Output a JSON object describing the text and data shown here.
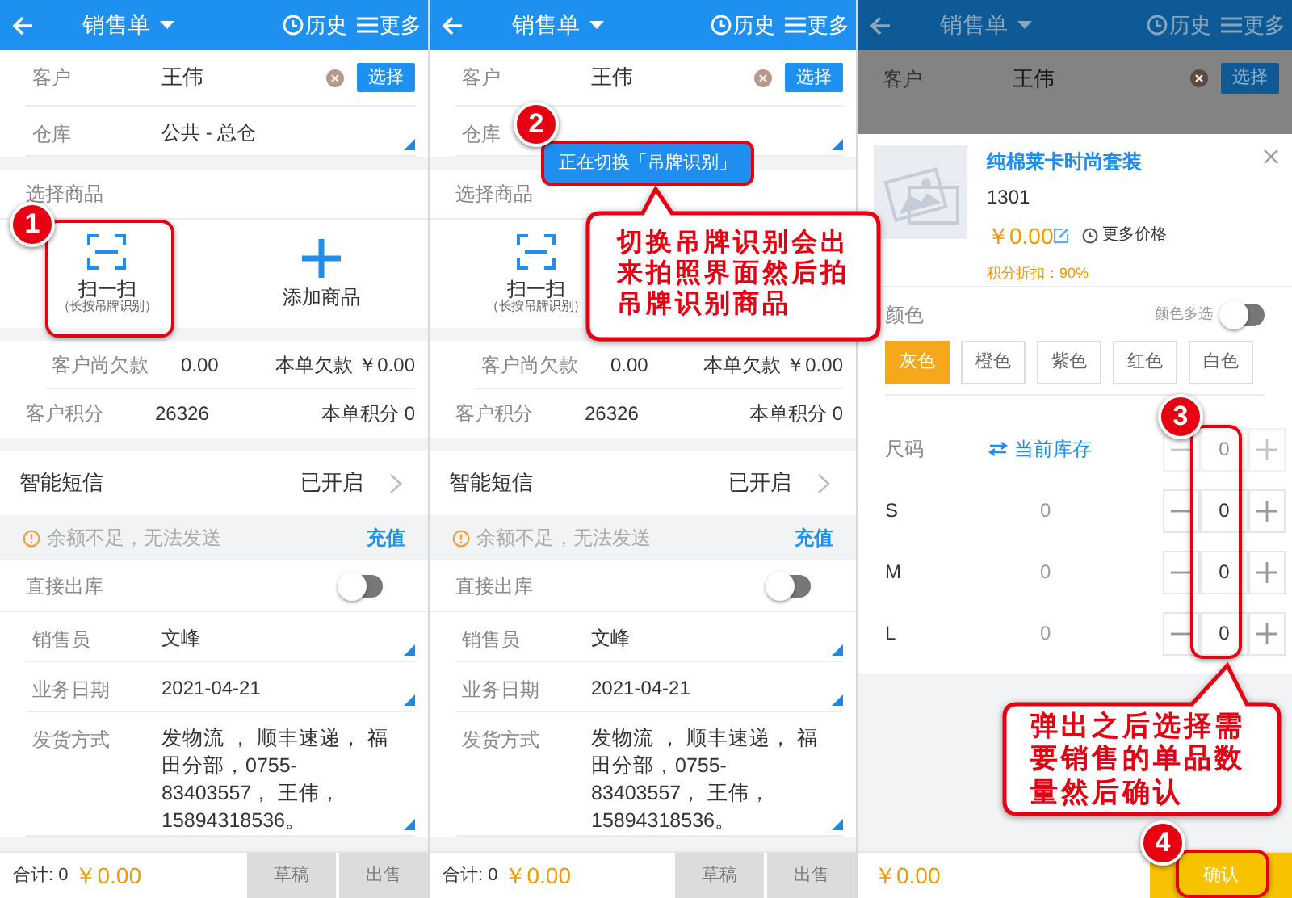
{
  "screens": [
    {
      "kind": "form",
      "header": {
        "title": "销售单",
        "history": "历史",
        "more": "更多"
      },
      "customer": {
        "label": "客户",
        "value": "王伟",
        "button": "选择"
      },
      "warehouse": {
        "label": "仓库",
        "value": "公共 - 总仓"
      },
      "goods_title": "选择商品",
      "tiles": [
        {
          "kind": "scan",
          "label": "扫一扫",
          "hint": "（长按吊牌识别）"
        },
        {
          "kind": "add",
          "label": "添加商品"
        }
      ],
      "stats": [
        {
          "label": "客户尚欠款",
          "value": "0.00",
          "extra": "本单欠款 ￥0.00"
        },
        {
          "label": "客户积分",
          "value": "26326",
          "extra": "本单积分 0"
        }
      ],
      "sms": {
        "label": "智能短信",
        "value": "已开启"
      },
      "notice": {
        "text": "余额不足，无法发送",
        "link": "充值"
      },
      "direct_out": {
        "label": "直接出库",
        "on": false
      },
      "fields": [
        {
          "label": "销售员",
          "value": "文峰"
        },
        {
          "label": "业务日期",
          "value": "2021-04-21"
        },
        {
          "label": "发货方式",
          "value": "发物流 ， 顺丰速递， 福田分部，0755-83403557， 王伟， 15894318536。"
        }
      ],
      "footer": {
        "total": "合计: 0",
        "amount": "￥0.00",
        "buttons": [
          {
            "label": "草稿",
            "disabled": true
          },
          {
            "label": "出售",
            "disabled": true
          }
        ]
      }
    },
    {
      "kind": "form",
      "header": {
        "title": "销售单",
        "history": "历史",
        "more": "更多"
      },
      "customer": {
        "label": "客户",
        "value": "王伟",
        "button": "选择"
      },
      "warehouse": {
        "label": "仓库"
      },
      "toast": "正在切换「吊牌识别」",
      "goods_title": "选择商品",
      "tiles": [
        {
          "kind": "scan",
          "label": "扫一扫",
          "hint": "（长按吊牌识别）"
        }
      ],
      "stats": [
        {
          "label": "客户尚欠款",
          "value": "0.00",
          "extra": "本单欠款 ￥0.00"
        },
        {
          "label": "客户积分",
          "value": "26326",
          "extra": "本单积分 0"
        }
      ],
      "sms": {
        "label": "智能短信",
        "value": "已开启"
      },
      "notice": {
        "text": "余额不足，无法发送",
        "link": "充值"
      },
      "direct_out": {
        "label": "直接出库",
        "on": false
      },
      "fields": [
        {
          "label": "销售员",
          "value": "文峰"
        },
        {
          "label": "业务日期",
          "value": "2021-04-21"
        },
        {
          "label": "发货方式",
          "value": "发物流 ， 顺丰速递， 福田分部，0755-83403557， 王伟， 15894318536。"
        }
      ],
      "footer": {
        "total": "合计: 0",
        "amount": "￥0.00",
        "buttons": [
          {
            "label": "草稿",
            "disabled": true
          },
          {
            "label": "出售",
            "disabled": true
          }
        ]
      }
    },
    {
      "kind": "sheet",
      "header": {
        "title": "销售单",
        "history": "历史",
        "more": "更多"
      },
      "customer": {
        "label": "客户",
        "value": "王伟",
        "button": "选择"
      },
      "product": {
        "name": "纯棉莱卡时尚套装",
        "code": "1301",
        "price": "￥0.00",
        "more_price": "更多价格",
        "points": "积分折扣：90%"
      },
      "color_section": {
        "label": "颜色",
        "multi_label": "颜色多选",
        "multi_on": false,
        "options": [
          {
            "label": "灰色",
            "selected": true
          },
          {
            "label": "橙色",
            "selected": false
          },
          {
            "label": "紫色",
            "selected": false
          },
          {
            "label": "红色",
            "selected": false
          },
          {
            "label": "白色",
            "selected": false
          }
        ]
      },
      "size_section": {
        "label": "尺码",
        "stock_link": "当前库存",
        "header_qty": "0",
        "rows": [
          {
            "size": "S",
            "stock": "0",
            "qty": "0"
          },
          {
            "size": "M",
            "stock": "0",
            "qty": "0"
          },
          {
            "size": "L",
            "stock": "0",
            "qty": "0"
          }
        ]
      },
      "footer": {
        "amount": "￥0.00",
        "button": "确认"
      }
    }
  ],
  "annotations": {
    "markers": [
      "1",
      "2",
      "3",
      "4"
    ],
    "callouts": [
      {
        "text": "切换吊牌识别会出来拍照界面然后拍吊牌识别商品"
      },
      {
        "text": "弹出之后选择需要销售的单品数量然后确认"
      }
    ]
  }
}
